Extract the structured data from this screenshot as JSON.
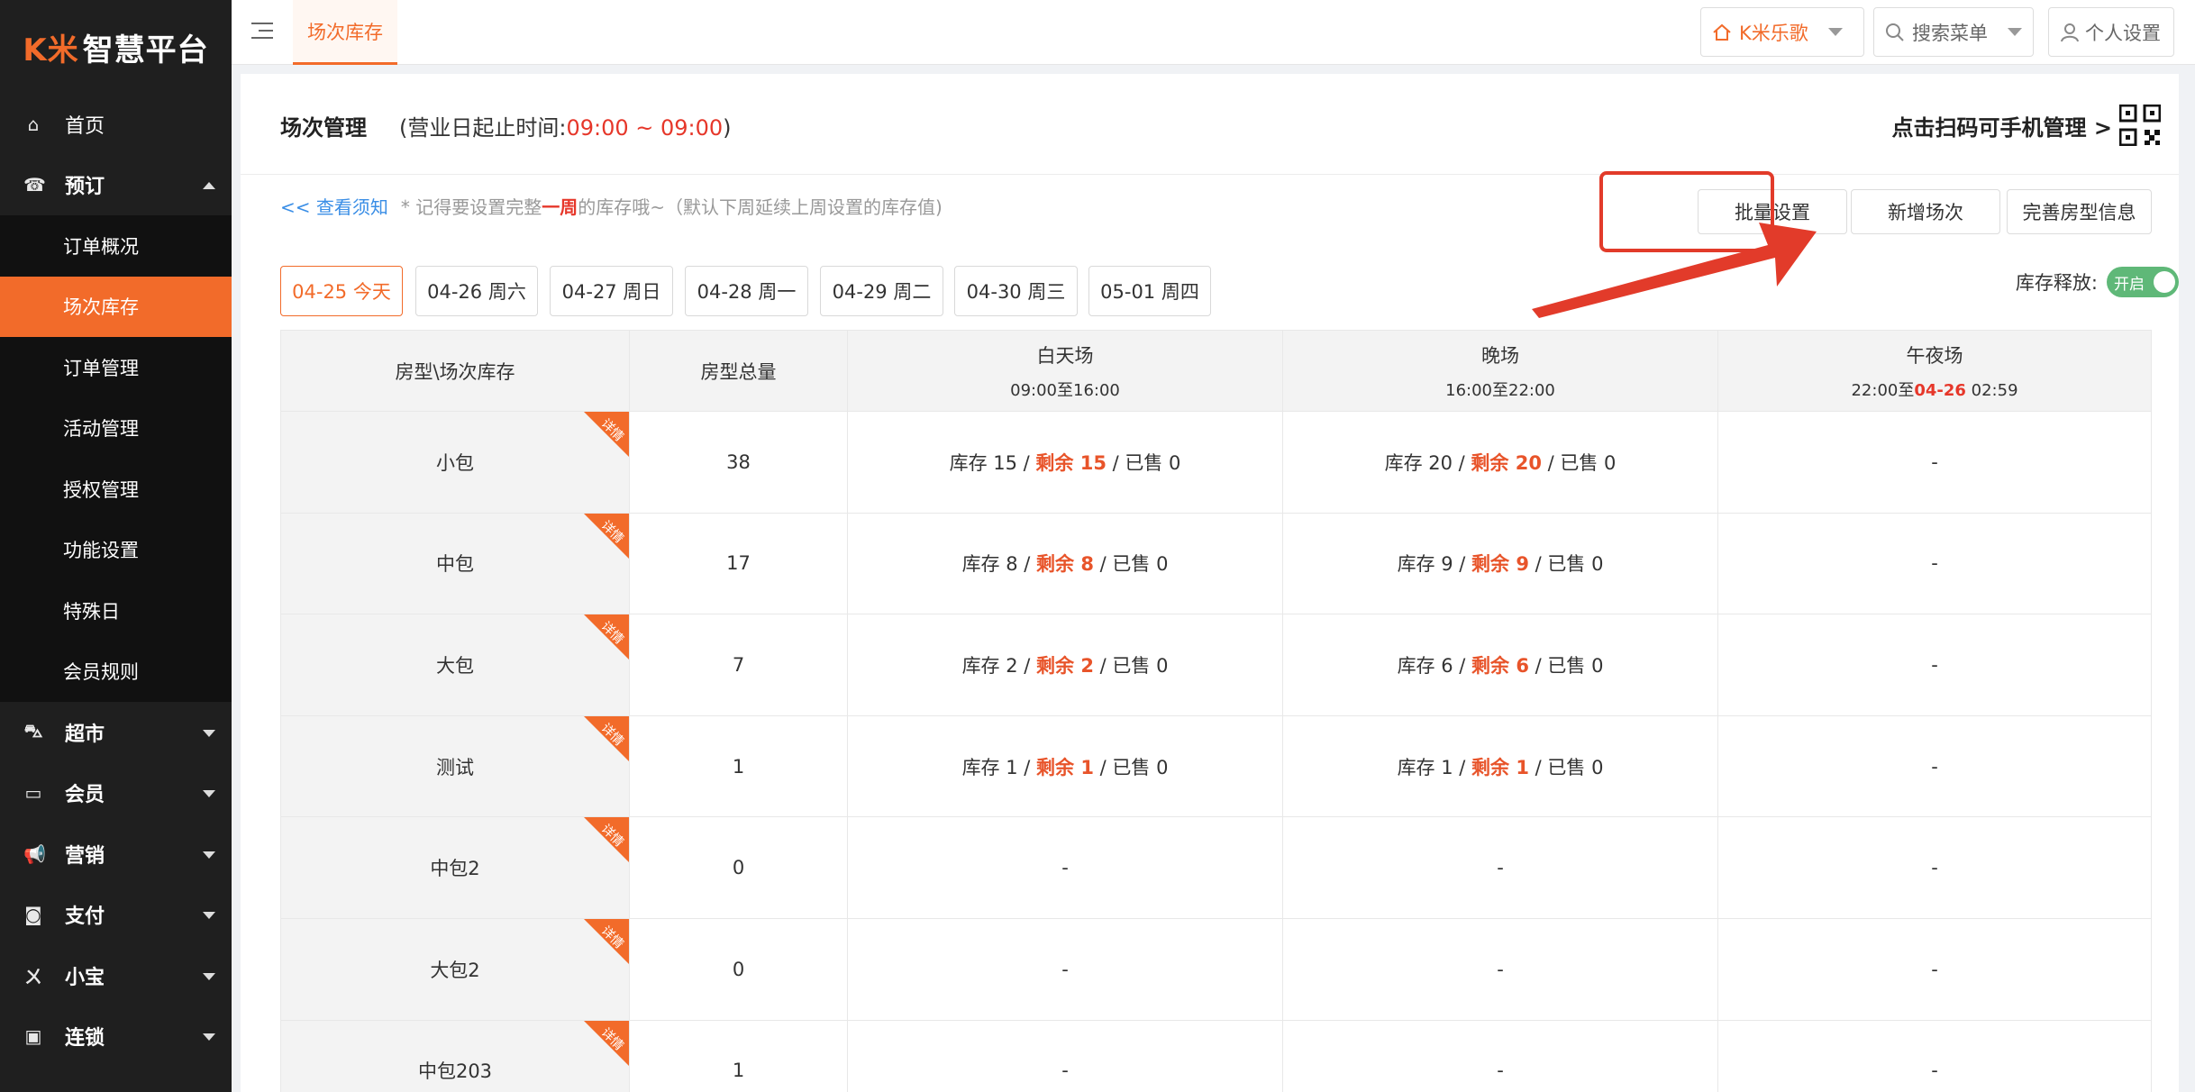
{
  "brand": {
    "logo_k": "K米",
    "logo_rest": "智慧平台",
    "accent": "#f26b2a"
  },
  "sidebar": {
    "items": [
      {
        "label": "首页",
        "icon": "home-icon",
        "glyph": "⌂"
      },
      {
        "label": "预订",
        "icon": "booking-icon",
        "glyph": "☎"
      }
    ],
    "sub_items": [
      {
        "label": "订单概况"
      },
      {
        "label": "场次库存"
      },
      {
        "label": "订单管理"
      },
      {
        "label": "活动管理"
      },
      {
        "label": "授权管理"
      },
      {
        "label": "功能设置"
      },
      {
        "label": "特殊日"
      },
      {
        "label": "会员规则"
      }
    ],
    "lower_items": [
      {
        "label": "超市",
        "icon": "basket-icon",
        "glyph": "⛍"
      },
      {
        "label": "会员",
        "icon": "card-icon",
        "glyph": "▭"
      },
      {
        "label": "营销",
        "icon": "megaphone-icon",
        "glyph": "📢"
      },
      {
        "label": "支付",
        "icon": "money-icon",
        "glyph": "◙"
      },
      {
        "label": "小宝",
        "icon": "xiaobao-icon",
        "glyph": "ㄨ"
      },
      {
        "label": "连锁",
        "icon": "bag-icon",
        "glyph": "▣"
      }
    ]
  },
  "topbar": {
    "active_tab": "场次库存",
    "store_label": "K米乐歌",
    "search_label": "搜索菜单",
    "settings_label": "个人设置"
  },
  "panel": {
    "title": "场次管理",
    "subtitle_prefix": "(营业日起止时间:",
    "subtitle_time": "09:00 ~ 09:00",
    "subtitle_suffix": ")",
    "qr_label": "点击扫码可手机管理 >"
  },
  "notice": {
    "link": "<< 查看须知",
    "text_a": "* 记得要设置完整",
    "text_hl": "一周",
    "text_b": "的库存哦~（默认下周延续上周设置的库存值)"
  },
  "actions": {
    "batch": "批量设置",
    "add_session": "新增场次",
    "room_info": "完善房型信息"
  },
  "dates": [
    "04-25 今天",
    "04-26 周六",
    "04-27 周日",
    "04-28 周一",
    "04-29 周二",
    "04-30 周三",
    "05-01 周四"
  ],
  "release": {
    "label": "库存释放:",
    "toggle_text": "开启",
    "enabled": true
  },
  "table": {
    "headers": {
      "room": "房型\\场次库存",
      "total": "房型总量",
      "day": {
        "name": "白天场",
        "time": "09:00至16:00"
      },
      "night": {
        "name": "晚场",
        "time": "16:00至22:00"
      },
      "midnight": {
        "name": "午夜场",
        "time_a": "22:00至",
        "time_date": "04-26",
        "time_b": " 02:59"
      }
    },
    "ribbon": "详情",
    "rows": [
      {
        "name": "小包",
        "total": "38",
        "day": {
          "stock": "库存 15 / ",
          "remain": "剩余 15",
          "sold": " / 已售 0"
        },
        "night": {
          "stock": "库存 20 / ",
          "remain": "剩余 20",
          "sold": " / 已售 0"
        },
        "midnight": "-"
      },
      {
        "name": "中包",
        "total": "17",
        "day": {
          "stock": "库存 8 / ",
          "remain": "剩余 8",
          "sold": " / 已售 0"
        },
        "night": {
          "stock": "库存 9 / ",
          "remain": "剩余 9",
          "sold": " / 已售 0"
        },
        "midnight": "-"
      },
      {
        "name": "大包",
        "total": "7",
        "day": {
          "stock": "库存 2 / ",
          "remain": "剩余 2",
          "sold": " / 已售 0"
        },
        "night": {
          "stock": "库存 6 / ",
          "remain": "剩余 6",
          "sold": " / 已售 0"
        },
        "midnight": "-"
      },
      {
        "name": "测试",
        "total": "1",
        "day": {
          "stock": "库存 1 / ",
          "remain": "剩余 1",
          "sold": " / 已售 0"
        },
        "night": {
          "stock": "库存 1 / ",
          "remain": "剩余 1",
          "sold": " / 已售 0"
        },
        "midnight": "-"
      },
      {
        "name": "中包2",
        "total": "0",
        "day_dash": "-",
        "night_dash": "-",
        "midnight": "-"
      },
      {
        "name": "大包2",
        "total": "0",
        "day_dash": "-",
        "night_dash": "-",
        "midnight": "-"
      },
      {
        "name": "中包203",
        "total": "1",
        "day_dash": "-",
        "night_dash": "-",
        "midnight": "-"
      }
    ]
  }
}
